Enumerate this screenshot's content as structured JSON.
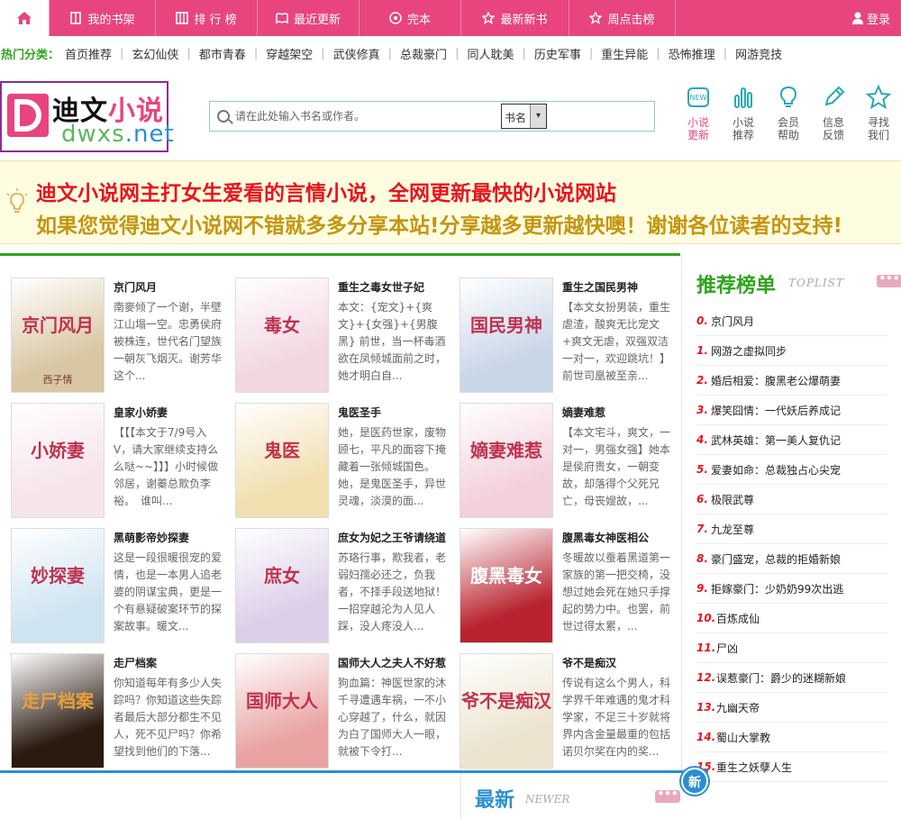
{
  "nav": {
    "items": [
      {
        "label": "我的书架",
        "icon": "book-icon"
      },
      {
        "label": "排 行 榜",
        "icon": "ranking-icon"
      },
      {
        "label": "最近更新",
        "icon": "open-book-icon"
      },
      {
        "label": "完本",
        "icon": "target-icon"
      },
      {
        "label": "最新新书",
        "icon": "star-icon"
      },
      {
        "label": "周点击榜",
        "icon": "star-icon"
      }
    ],
    "login": "登录"
  },
  "categories": {
    "title": "热门分类：",
    "items": [
      "首页推荐",
      "玄幻仙侠",
      "都市青春",
      "穿越架空",
      "武侠修真",
      "总裁豪门",
      "同人耽美",
      "历史军事",
      "重生异能",
      "恐怖推理",
      "网游竞技"
    ]
  },
  "logo": {
    "cn_black": "迪文",
    "cn_pink": "小说",
    "url_a": "dwxs",
    "url_b": ".net",
    "letter": "D"
  },
  "search": {
    "placeholder": "请在此处输入书名或作者。",
    "select_value": "书名"
  },
  "quicklinks": [
    {
      "label1": "小说",
      "label2": "更新",
      "icon": "new-badge-icon"
    },
    {
      "label1": "小说",
      "label2": "推荐",
      "icon": "bar-chart-icon"
    },
    {
      "label1": "会员",
      "label2": "帮助",
      "icon": "lightbulb-icon"
    },
    {
      "label1": "信息",
      "label2": "反馈",
      "icon": "pencil-icon"
    },
    {
      "label1": "寻找",
      "label2": "我们",
      "icon": "star-icon"
    }
  ],
  "banner": {
    "line1": "迪文小说网主打女生爱看的言情小说，全网更新最快的小说网站",
    "line2": "如果您觉得迪文小说网不错就多多分享本站!分享越多更新越快噢！谢谢各位读者的支持!"
  },
  "books": [
    {
      "title": "京门风月",
      "desc": "南麥倾了一个谢，半壁江山塌一空。忠勇侯府被株连，世代名门望族一朝灰飞烟灭。谢芳华这个...",
      "cover_text": "京门风月",
      "cover_author": "西子情",
      "color": "#d9c6a3"
    },
    {
      "title": "重生之毒女世子妃",
      "desc": "本文：{宠文}+{爽文}+{女强}+{男腹黑} 前世，当一杯毒酒欲在凤倾城面前之时，她才明白自...",
      "cover_text": "毒女",
      "cover_author": "",
      "color": "#f2d6e2"
    },
    {
      "title": "重生之国民男神",
      "desc": "【本文女扮男装，重生虐渣，酸爽无比宠文+爽文无虐，双强双洁一对一，欢迎跳坑！】前世司凰被至亲...",
      "cover_text": "国民男神",
      "cover_author": "",
      "color": "#c9d6e8"
    },
    {
      "title": "皇家小娇妻",
      "desc": "【【【本文于7/9号入V，请大家继续支持么么哒~~】】】小时候做邻居，谢蓁总欺负李裕。　谁叫...",
      "cover_text": "小娇妻",
      "cover_author": "",
      "color": "#f6e3ec"
    },
    {
      "title": "鬼医圣手",
      "desc": "她，是医药世家，废物顾七，平凡的面容下掩藏着一张倾城国色。她，是鬼医圣手，异世灵魂，淡漠的面...",
      "cover_text": "鬼医",
      "cover_author": "",
      "color": "#f1dfb0"
    },
    {
      "title": "嫡妻难惹",
      "desc": "【本文宅斗，爽文，一对一，男强女强】她本是侯府贵女，一朝变故，却落得个父死兄亡，母丧嫂故，...",
      "cover_text": "嫡妻难惹",
      "cover_author": "",
      "color": "#f3d1dc"
    },
    {
      "title": "黑萌影帝妙探妻",
      "desc": "这是一段很暖很宠的爱情，也是一本男人追老婆的阴谋宝典，更是一个有悬疑破案环节的探案故事。暖文...",
      "cover_text": "妙探妻",
      "cover_author": "",
      "color": "#cfe4f1"
    },
    {
      "title": "庶女为妃之王爷请绕道",
      "desc": "苏珞行事，欺我者，老弱妇孺必还之，负我者，不择手段送地狱！一招穿越沦为人见人踩，没人疼没人...",
      "cover_text": "庶女",
      "cover_author": "",
      "color": "#dccfe8"
    },
    {
      "title": "腹黑毒女神医相公",
      "desc": "冬暖故以蚕着黑道第一家族的第一把交椅，没想过她会死在她只手撑起的势力中。也罢，前世过得太累，...",
      "cover_text": "腹黑毒女",
      "cover_author": "",
      "color": "#b8232f"
    },
    {
      "title": "走尸档案",
      "desc": "你知道每年有多少人失踪吗？你知道这些失踪者最后大部分都生不见人，死不见尸吗？你希望找到他们的下落...",
      "cover_text": "走尸档案",
      "cover_author": "",
      "color": "#2a1a10"
    },
    {
      "title": "国师大人之夫人不好惹",
      "desc": "狗血篇：神医世家的沐千寻遭遇车祸，一不小心穿越了，什么，就因为白了国师大人一眼，就被下令打...",
      "cover_text": "国师大人",
      "cover_author": "",
      "color": "#e9a3a3"
    },
    {
      "title": "爷不是痴汉",
      "desc": "传说有这么个男人，科学界千年难遇的鬼才科学家，不足三十岁就将界内含金量最重的包括诺贝尔奖在内的奖...",
      "cover_text": "爷不是痴汉",
      "cover_author": "",
      "color": "#ece4cf"
    }
  ],
  "sidebar": {
    "title": "推荐榜单",
    "subtitle": "TOPLIST",
    "more": "•••",
    "items": [
      "京门风月",
      "网游之虚拟同步",
      "婚后相爱：腹黑老公爆萌妻",
      "爆笑囧情：一代妖后养成记",
      "武林英雄：第一美人复仇记",
      "爱妻如命：总裁独占心尖宠",
      "极限武尊",
      "九龙至尊",
      "豪门盛宠，总裁的拒婚新娘",
      "拒嫁豪门：少奶奶99次出逃",
      "百炼成仙",
      "尸凶",
      "误惹豪门：爵少的迷糊新娘",
      "九幽天帝",
      "蜀山大掌教",
      "重生之妖孽人生"
    ]
  },
  "bottom": {
    "title": "最新",
    "subtitle": "NEWER",
    "more": "•••",
    "badge": "新"
  },
  "colors": {
    "brand": "#e8457f",
    "green": "#2ea31d",
    "blue": "#2a8fd1",
    "red": "#e8141d",
    "gold": "#c49510"
  }
}
